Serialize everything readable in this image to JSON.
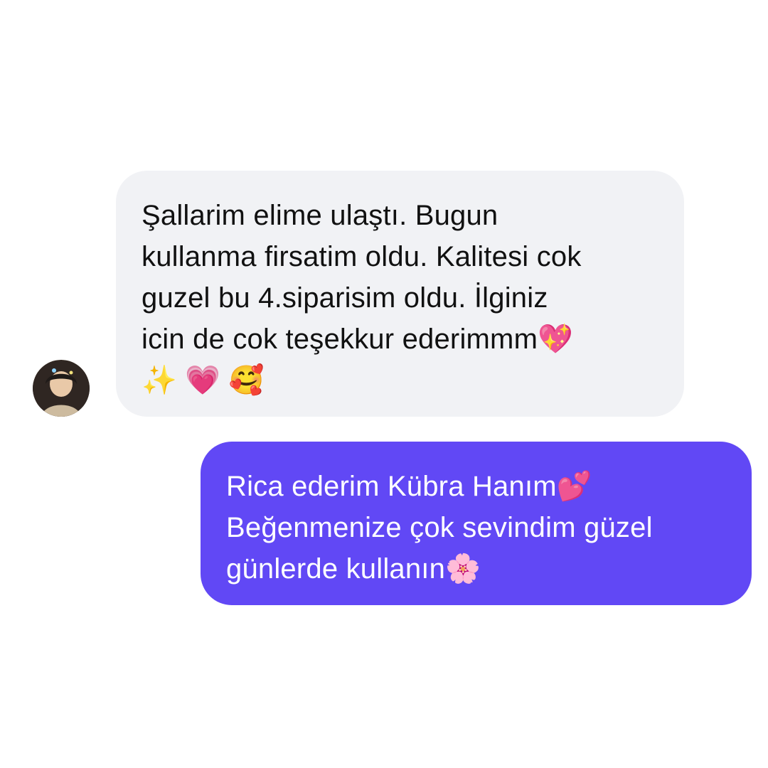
{
  "conversation": {
    "received": {
      "avatar_icon": "profile-photo",
      "lines": [
        "Şallarim elime ulaştı. Bugun",
        "kullanma firsatim oldu. Kalitesi cok",
        "guzel bu 4.siparisim oldu. İlginiz",
        "icin de cok teşekkur ederimmm💖",
        "✨ 💗 🥰"
      ],
      "bubble_color": "#f1f2f5",
      "text_color": "#111111"
    },
    "sent": {
      "lines": [
        "Rica ederim Kübra Hanım💕",
        "Beğenmenize çok sevindim güzel",
        "günlerde kullanın🌸"
      ],
      "bubble_color": "#6148f5",
      "text_color": "#ffffff"
    }
  }
}
